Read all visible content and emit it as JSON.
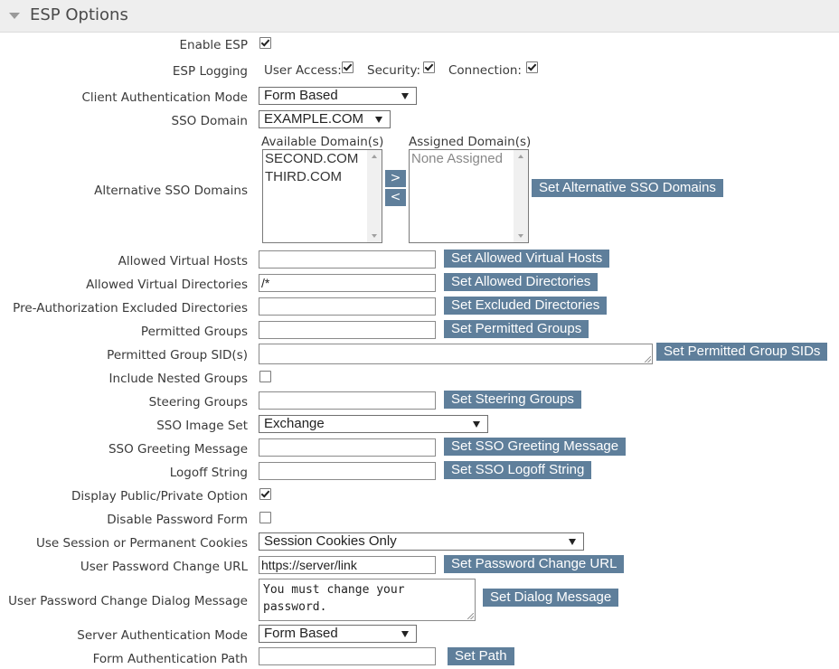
{
  "panel": {
    "title": "ESP Options"
  },
  "enable_esp": {
    "label": "Enable ESP",
    "checked": true
  },
  "esp_logging": {
    "label": "ESP Logging",
    "user_access": {
      "label": "User Access:",
      "checked": true
    },
    "security": {
      "label": "Security:",
      "checked": true
    },
    "connection": {
      "label": "Connection:",
      "checked": true
    }
  },
  "client_auth_mode": {
    "label": "Client Authentication Mode",
    "value": "Form Based"
  },
  "sso_domain": {
    "label": "SSO Domain",
    "value": "EXAMPLE.COM"
  },
  "alt_sso_domains": {
    "label": "Alternative SSO Domains",
    "available_label": "Available Domain(s)",
    "assigned_label": "Assigned Domain(s)",
    "available": [
      "SECOND.COM",
      "THIRD.COM"
    ],
    "assigned_placeholder": "None Assigned",
    "add_label": ">",
    "remove_label": "<",
    "button": "Set Alternative SSO Domains"
  },
  "allowed_virtual_hosts": {
    "label": "Allowed Virtual Hosts",
    "value": "",
    "button": "Set Allowed Virtual Hosts"
  },
  "allowed_virtual_directories": {
    "label": "Allowed Virtual Directories",
    "value": "/*",
    "button": "Set Allowed Directories"
  },
  "preauth_excluded_directories": {
    "label": "Pre-Authorization Excluded Directories",
    "value": "",
    "button": "Set Excluded Directories"
  },
  "permitted_groups": {
    "label": "Permitted Groups",
    "value": "",
    "button": "Set Permitted Groups"
  },
  "permitted_group_sids": {
    "label": "Permitted Group SID(s)",
    "value": "",
    "button": "Set Permitted Group SIDs"
  },
  "include_nested_groups": {
    "label": "Include Nested Groups",
    "checked": false
  },
  "steering_groups": {
    "label": "Steering Groups",
    "value": "",
    "button": "Set Steering Groups"
  },
  "sso_image_set": {
    "label": "SSO Image Set",
    "value": "Exchange"
  },
  "sso_greeting_message": {
    "label": "SSO Greeting Message",
    "value": "",
    "button": "Set SSO Greeting Message"
  },
  "logoff_string": {
    "label": "Logoff String",
    "value": "",
    "button": "Set SSO Logoff String"
  },
  "display_public_private": {
    "label": "Display Public/Private Option",
    "checked": true
  },
  "disable_password_form": {
    "label": "Disable Password Form",
    "checked": false
  },
  "session_cookies": {
    "label": "Use Session or Permanent Cookies",
    "value": "Session Cookies Only"
  },
  "password_change_url": {
    "label": "User Password Change URL",
    "value": "https://server/link",
    "button": "Set Password Change URL"
  },
  "password_change_dialog": {
    "label": "User Password Change Dialog Message",
    "value": "You must change your\npassword.",
    "button": "Set Dialog Message"
  },
  "server_auth_mode": {
    "label": "Server Authentication Mode",
    "value": "Form Based"
  },
  "form_auth_path": {
    "label": "Form Authentication Path",
    "value": "",
    "button": "Set Path"
  }
}
